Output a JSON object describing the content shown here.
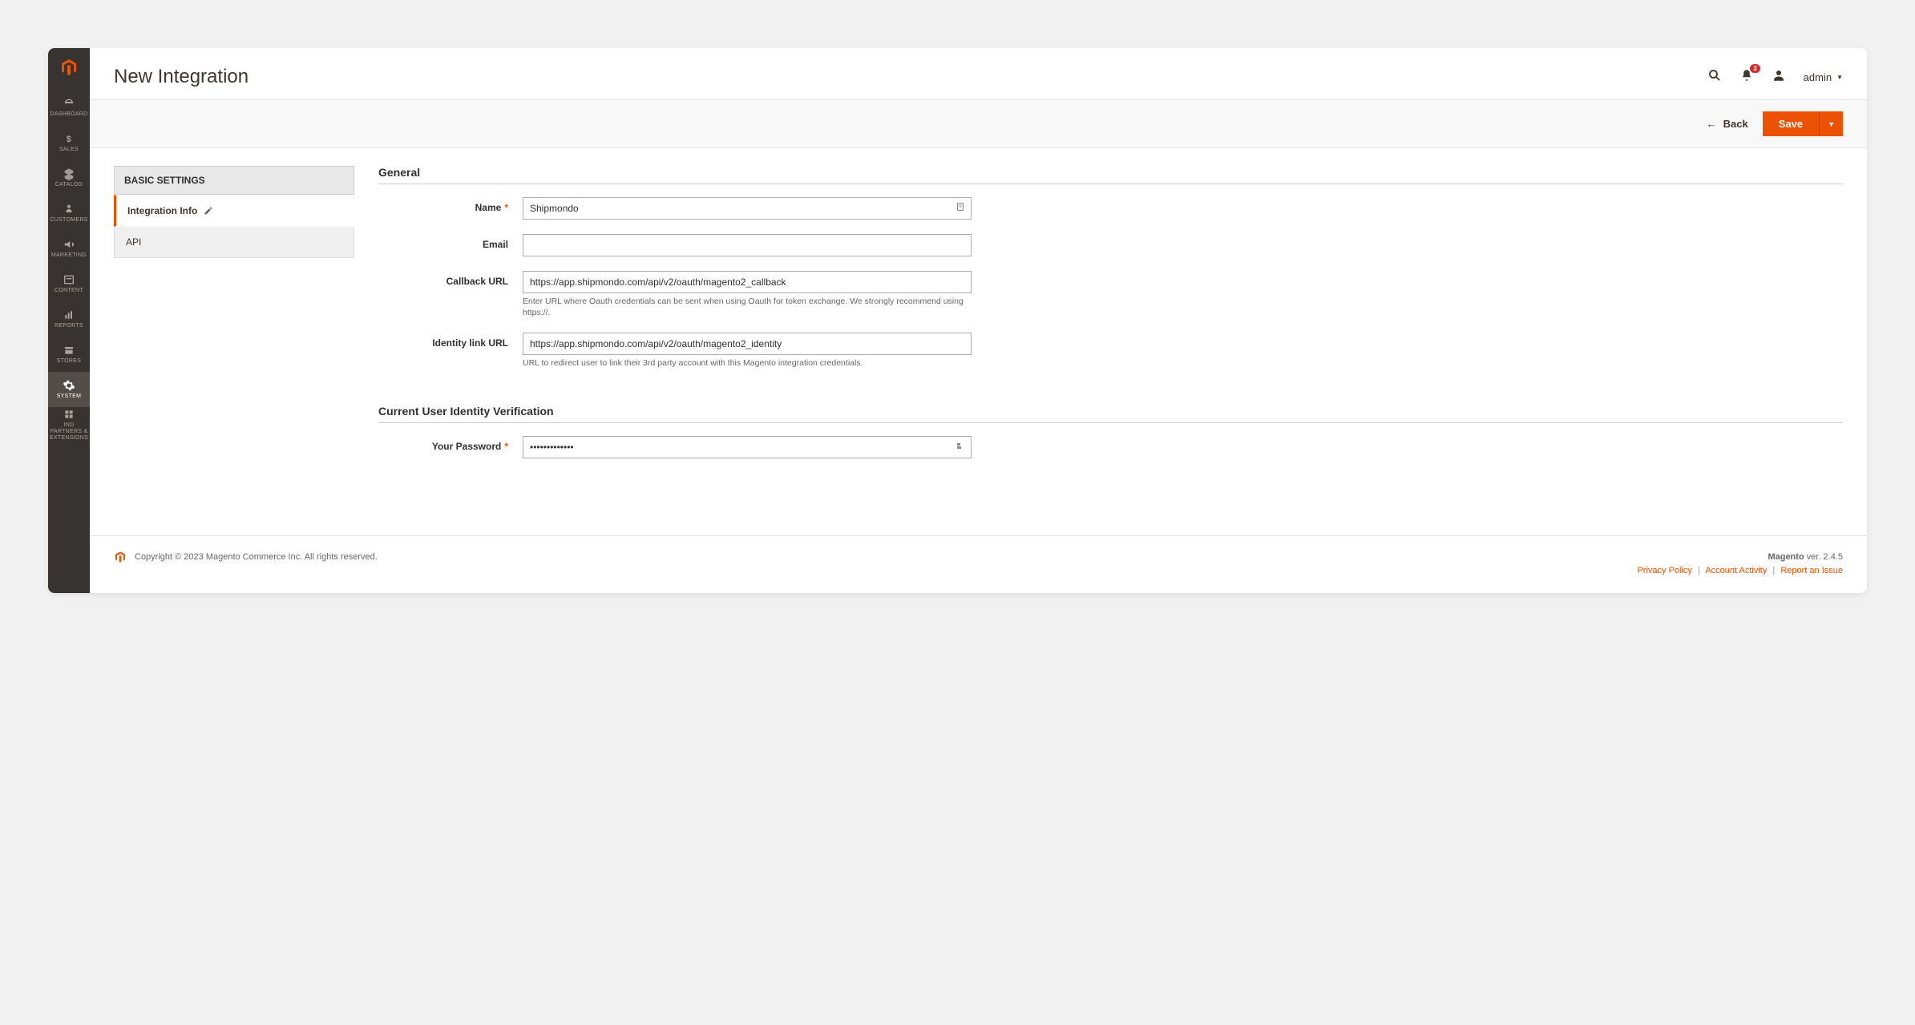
{
  "header": {
    "title": "New Integration",
    "notification_count": "3",
    "user": "admin"
  },
  "action_bar": {
    "back_label": "Back",
    "save_label": "Save"
  },
  "sidebar": {
    "items": [
      {
        "label": "DASHBOARD"
      },
      {
        "label": "SALES"
      },
      {
        "label": "CATALOG"
      },
      {
        "label": "CUSTOMERS"
      },
      {
        "label": "MARKETING"
      },
      {
        "label": "CONTENT"
      },
      {
        "label": "REPORTS"
      },
      {
        "label": "STORES"
      },
      {
        "label": "SYSTEM"
      },
      {
        "label": "IND PARTNERS & EXTENSIONS"
      }
    ]
  },
  "tabs": {
    "heading": "BASIC SETTINGS",
    "integration_info": "Integration Info",
    "api": "API"
  },
  "form": {
    "general_title": "General",
    "name_label": "Name",
    "name_value": "Shipmondo",
    "email_label": "Email",
    "email_value": "",
    "callback_label": "Callback URL",
    "callback_value": "https://app.shipmondo.com/api/v2/oauth/magento2_callback",
    "callback_help": "Enter URL where Oauth credentials can be sent when using Oauth for token exchange. We strongly recommend using https://.",
    "identity_label": "Identity link URL",
    "identity_value": "https://app.shipmondo.com/api/v2/oauth/magento2_identity",
    "identity_help": "URL to redirect user to link their 3rd party account with this Magento integration credentials.",
    "verification_title": "Current User Identity Verification",
    "password_label": "Your Password",
    "password_value": "•••••••••••••"
  },
  "footer": {
    "copyright": "Copyright © 2023 Magento Commerce Inc. All rights reserved.",
    "brand": "Magento",
    "version": "ver. 2.4.5",
    "privacy": "Privacy Policy",
    "activity": "Account Activity",
    "report": "Report an Issue"
  }
}
